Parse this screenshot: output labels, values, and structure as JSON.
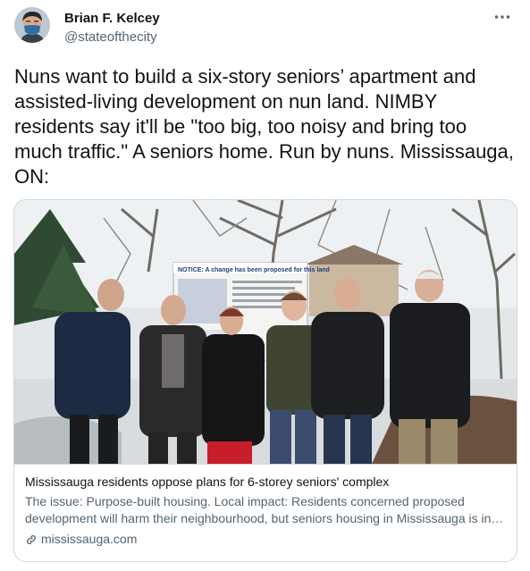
{
  "author": {
    "display_name": "Brian F. Kelcey",
    "handle": "@stateofthecity"
  },
  "tweet": {
    "text": "Nuns want to build a six-story seniors’ apartment and assisted-living development on nun land. NIMBY residents say it'll be \"too big, too noisy and bring too much traffic.\" A seniors home. Run by nuns. Mississauga, ON:"
  },
  "card": {
    "sign_heading": "NOTICE: A change has been proposed for this land",
    "title": "Mississauga residents oppose plans for 6-storey seniors' complex",
    "description": "The issue: Purpose-built housing. Local impact: Residents concerned proposed development will harm their neighbourhood, but seniors housing in Mississauga is in short supply.",
    "domain": "mississauga.com"
  },
  "icons": {
    "more": "more-horizontal-icon",
    "link": "link-icon"
  },
  "colors": {
    "text_primary": "#0f1419",
    "text_secondary": "#536471",
    "border": "#cfd9de",
    "avatar_mask": "#2d6fa8"
  }
}
